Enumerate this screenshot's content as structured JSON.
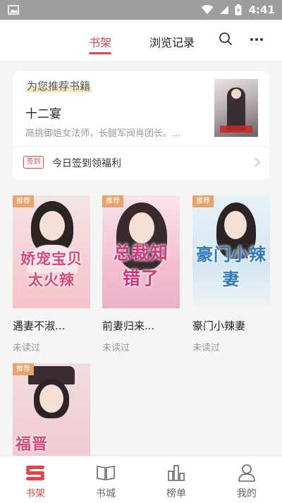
{
  "status_bar": {
    "time": "4:41"
  },
  "top_tabs": {
    "shelf": "书架",
    "history": "浏览记录"
  },
  "recommend": {
    "heading": "为您推荐书籍",
    "title": "十二宴",
    "description": "高挑御姐女法师，长腿军阀肖团长。...",
    "signin_badge": "签到",
    "signin_text": "今日签到领福利"
  },
  "books": [
    {
      "badge": "推荐",
      "cover_title": "娇宠宝贝太火辣",
      "title": "遇妻不淑...",
      "status": "未读过"
    },
    {
      "badge": "推荐",
      "cover_title": "总裁知错了",
      "title": "前妻归来...",
      "status": "未读过"
    },
    {
      "badge": "推荐",
      "cover_title": "豪门小辣妻",
      "title": "豪门小辣妻",
      "status": "未读过"
    },
    {
      "badge": "推荐",
      "cover_title": "福晋",
      "title": "",
      "status": ""
    }
  ],
  "bottom_nav": [
    {
      "label": "书架",
      "icon": "bookshelf-icon",
      "active": true
    },
    {
      "label": "书城",
      "icon": "open-book-icon",
      "active": false
    },
    {
      "label": "榜单",
      "icon": "ranking-icon",
      "active": false
    },
    {
      "label": "我的",
      "icon": "person-icon",
      "active": false
    }
  ],
  "colors": {
    "accent": "#e0454b",
    "badge": "#e9a26a",
    "status_bar": "#9e9e9e"
  }
}
